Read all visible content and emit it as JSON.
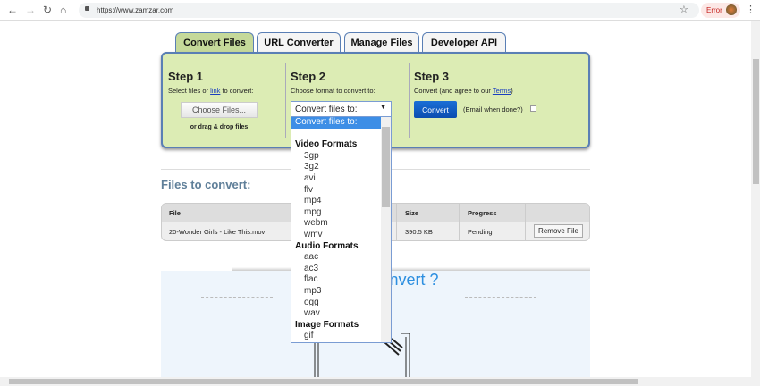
{
  "browser": {
    "url": "https://www.zamzar.com",
    "error_label": "Error"
  },
  "tabs": [
    {
      "label": "Convert Files",
      "active": true
    },
    {
      "label": "URL Converter"
    },
    {
      "label": "Manage Files"
    },
    {
      "label": "Developer API"
    }
  ],
  "step1": {
    "title": "Step 1",
    "text_before": "Select files or ",
    "link": "link",
    "text_after": " to convert:",
    "button": "Choose Files...",
    "drag": "or drag & drop files"
  },
  "step2": {
    "title": "Step 2",
    "text": "Choose format to convert to:",
    "select_value": "Convert files to:",
    "options": [
      {
        "label": "Convert files to:",
        "type": "selected"
      },
      {
        "label": "",
        "type": "blank"
      },
      {
        "label": "Video Formats",
        "type": "group"
      },
      {
        "label": "3gp"
      },
      {
        "label": "3g2"
      },
      {
        "label": "avi"
      },
      {
        "label": "flv"
      },
      {
        "label": "mp4"
      },
      {
        "label": "mpg"
      },
      {
        "label": "webm"
      },
      {
        "label": "wmv"
      },
      {
        "label": "Audio Formats",
        "type": "group"
      },
      {
        "label": "aac"
      },
      {
        "label": "ac3"
      },
      {
        "label": "flac"
      },
      {
        "label": "mp3"
      },
      {
        "label": "ogg"
      },
      {
        "label": "wav"
      },
      {
        "label": "Image Formats",
        "type": "group"
      },
      {
        "label": "gif"
      }
    ]
  },
  "step3": {
    "title": "Step 3",
    "text_before": "Convert (and agree to our ",
    "link": "Terms",
    "text_after": ")",
    "button": "Convert",
    "email": "(Email when done?)"
  },
  "files": {
    "title": "Files to convert:",
    "headers": {
      "file": "File",
      "size": "Size",
      "progress": "Progress"
    },
    "rows": [
      {
        "file": "20-Wonder Girls - Like This.mov",
        "size": "390.5 KB",
        "progress": "Pending",
        "action": "Remove File"
      }
    ]
  },
  "promo": {
    "title": "What to convert ?"
  },
  "colors": {
    "panel": "#dcecb4",
    "accent": "#0b4db0",
    "active_tab": "#c5d99a"
  }
}
